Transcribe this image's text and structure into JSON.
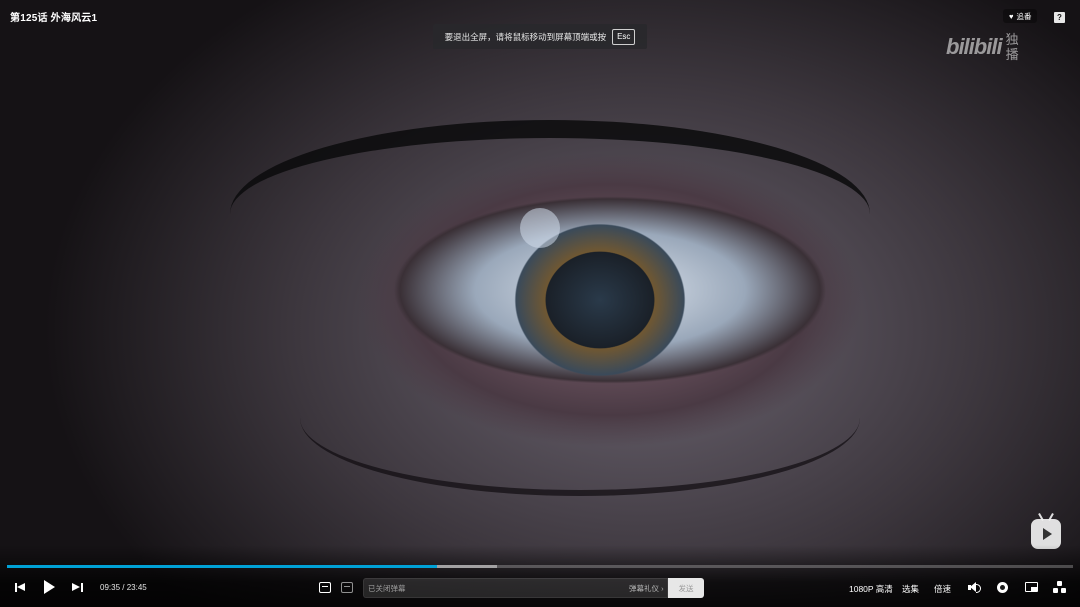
{
  "player": {
    "episode_title": "第125话 外海风云1",
    "fullscreen_hint": "要退出全屏，请将鼠标移动到屏幕顶端或按",
    "esc_key": "Esc",
    "follow_label": "追番",
    "help_label": "?",
    "watermark": {
      "brand": "bilibili",
      "tag_line1": "独",
      "tag_line2": "播"
    }
  },
  "progress": {
    "current_time": "09:35",
    "separator": "/",
    "total_time": "23:45",
    "played_fraction": 0.403,
    "buffered_fraction": 0.46,
    "accent_color": "#00a1d6"
  },
  "danmaku": {
    "input_placeholder": "已关闭弹幕",
    "etiquette_link": "弹幕礼仪 ›",
    "send_label": "发送"
  },
  "controls": {
    "quality": "1080P 高清",
    "episodes": "选集",
    "speed": "倍速"
  },
  "icons": {
    "prev": "previous-episode-icon",
    "play": "play-icon",
    "next": "next-episode-icon",
    "danmaku_toggle": "danmaku-toggle-icon",
    "danmaku_settings": "danmaku-settings-icon",
    "volume": "volume-icon",
    "settings": "gear-icon",
    "pip": "picture-in-picture-icon",
    "fullscreen": "fullscreen-icon",
    "tv": "tv-icon"
  }
}
